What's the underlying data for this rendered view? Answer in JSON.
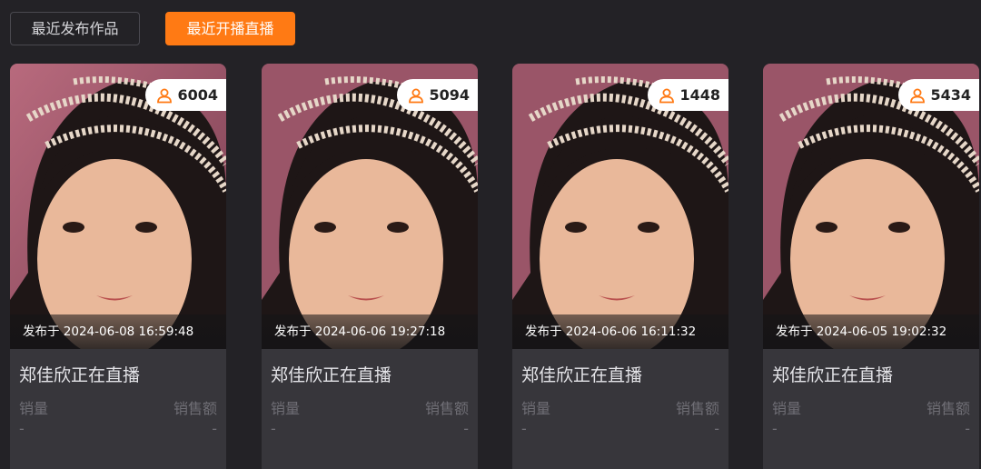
{
  "tabs": {
    "recent_works": "最近发布作品",
    "recent_live": "最近开播直播"
  },
  "accent_color": "#ff7a14",
  "cards": [
    {
      "viewer_icon": "user-icon",
      "viewers": "6004",
      "time": "发布于 2024-06-08 16:59:48",
      "title": "郑佳欣正在直播",
      "sales_label": "销量",
      "sales_value": "-",
      "revenue_label": "销售额",
      "revenue_value": "-"
    },
    {
      "viewer_icon": "user-icon",
      "viewers": "5094",
      "time": "发布于 2024-06-06 19:27:18",
      "title": "郑佳欣正在直播",
      "sales_label": "销量",
      "sales_value": "-",
      "revenue_label": "销售额",
      "revenue_value": "-"
    },
    {
      "viewer_icon": "user-icon",
      "viewers": "1448",
      "time": "发布于 2024-06-06 16:11:32",
      "title": "郑佳欣正在直播",
      "sales_label": "销量",
      "sales_value": "-",
      "revenue_label": "销售额",
      "revenue_value": "-"
    },
    {
      "viewer_icon": "user-icon",
      "viewers": "5434",
      "time": "发布于 2024-06-05 19:02:32",
      "title": "郑佳欣正在直播",
      "sales_label": "销量",
      "sales_value": "-",
      "revenue_label": "销售额",
      "revenue_value": "-"
    }
  ]
}
